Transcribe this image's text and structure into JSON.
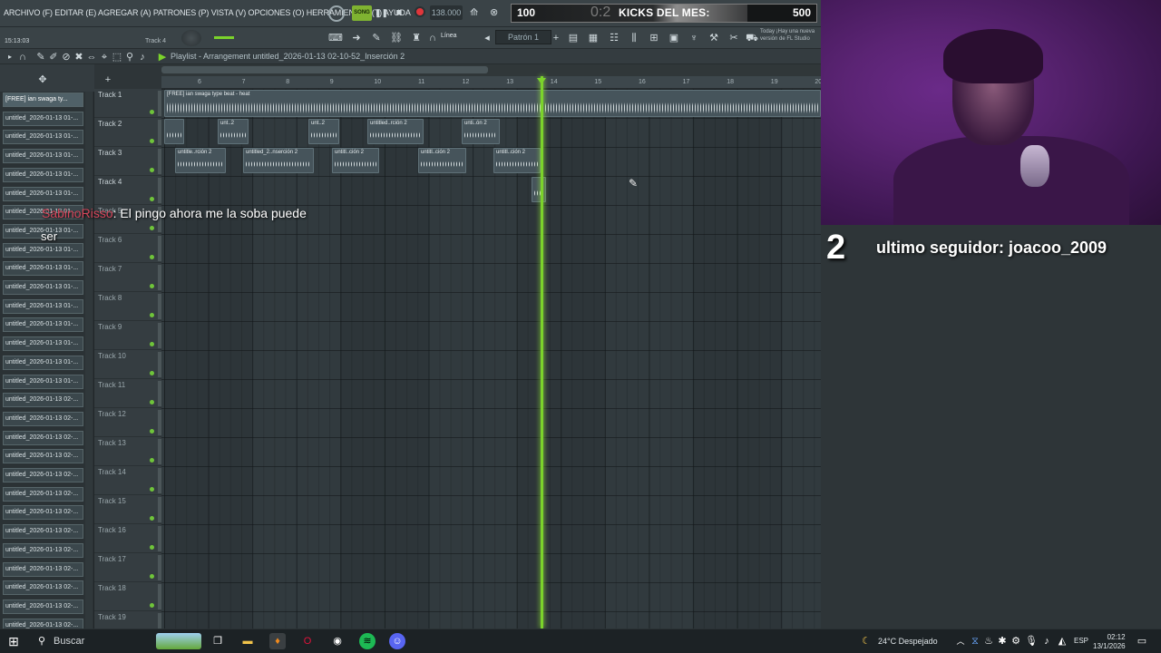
{
  "menu": {
    "items": "ARCHIVO (F) EDITAR (E) AGREGAR (A) PATRONES (P) VISTA (V) OPCIONES (O) HERRAMIENTAS (T) AYUDA"
  },
  "transport": {
    "song_label": "SONG",
    "tempo": "138.000",
    "time_small": "15:13:03",
    "track_hint": "Track 4"
  },
  "toolbar": {
    "snap_label": "Línea",
    "pattern_label": "Patrón 1",
    "hint": "Today ¡Hay una nueva versión de FL Studio"
  },
  "goal": {
    "start": "100",
    "time": "0:2",
    "label": "KICKS DEL MES:",
    "end": "500"
  },
  "playlist": {
    "title": "Playlist - Arrangement   untitled_2026-01-13 02-10-52_Inserción 2"
  },
  "ruler": [
    "6",
    "7",
    "8",
    "9",
    "10",
    "11",
    "12",
    "13",
    "14",
    "15",
    "16",
    "17",
    "18",
    "19",
    "20"
  ],
  "browser": {
    "patterns": [
      "[FREE] ian  swaga ty...",
      "untitled_2026-01-13 01-...",
      "untitled_2026-01-13 01-...",
      "untitled_2026-01-13 01-...",
      "untitled_2026-01-13 01-...",
      "untitled_2026-01-13 01-...",
      "untitled_2026-01-13 01-...",
      "untitled_2026-01-13 01-...",
      "untitled_2026-01-13 01-...",
      "untitled_2026-01-13 01-...",
      "untitled_2026-01-13 01-...",
      "untitled_2026-01-13 01-...",
      "untitled_2026-01-13 01-...",
      "untitled_2026-01-13 01-...",
      "untitled_2026-01-13 01-...",
      "untitled_2026-01-13 01-...",
      "untitled_2026-01-13 02-...",
      "untitled_2026-01-13 02-...",
      "untitled_2026-01-13 02-...",
      "untitled_2026-01-13 02-...",
      "untitled_2026-01-13 02-...",
      "untitled_2026-01-13 02-...",
      "untitled_2026-01-13 02-...",
      "untitled_2026-01-13 02-...",
      "untitled_2026-01-13 02-...",
      "untitled_2026-01-13 02-...",
      "untitled_2026-01-13 02-...",
      "untitled_2026-01-13 02-...",
      "untitled_2026-01-13 02-..."
    ]
  },
  "tracks": [
    "Track 1",
    "Track 2",
    "Track 3",
    "Track 4",
    "Track 5",
    "Track 6",
    "Track 7",
    "Track 8",
    "Track 9",
    "Track 10",
    "Track 11",
    "Track 12",
    "Track 13",
    "Track 14",
    "Track 15",
    "Track 16",
    "Track 17",
    "Track 18",
    "Track 19"
  ],
  "clips": {
    "t1": "[FREE] ian  swaga type beat - heat",
    "t2a": "unt..2",
    "t2b": "unt..2",
    "t2c": "untitled..rción 2",
    "t2d": "unti..ón 2",
    "t3a": "untitle..rción 2",
    "t3b": "untitled_2..nserción 2",
    "t3c": "untitl..ción 2",
    "t3d": "untitl..ción 2",
    "t3e": "untitl..ción 2"
  },
  "chat": {
    "user": "SabinoRisso",
    "message": ": El pingo ahora me la soba puede",
    "wrap": "ser"
  },
  "follower": {
    "count": "2",
    "text": "ultimo seguidor: joacoo_2009"
  },
  "taskbar": {
    "search": "Buscar",
    "weather": "24°C  Despejado",
    "lang": "ESP",
    "time": "02:12",
    "date": "13/1/2026"
  },
  "colors": {
    "accent_green": "#7bd32b",
    "record_red": "#e1363b",
    "chat_user": "#d4455a"
  }
}
